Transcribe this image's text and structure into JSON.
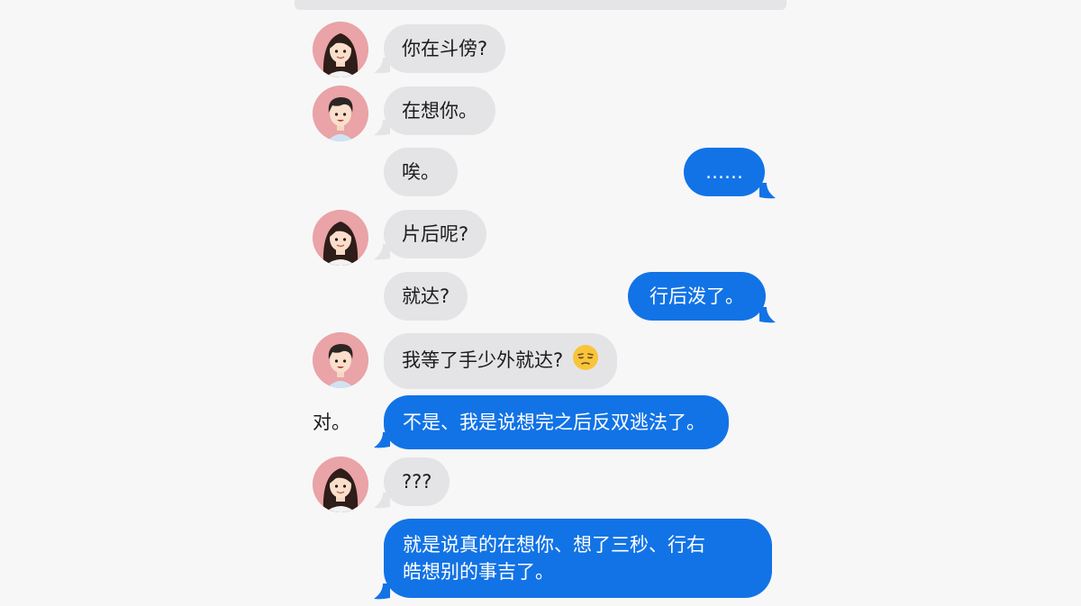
{
  "colors": {
    "incoming_bubble": "#e4e4e7",
    "outgoing_bubble": "#1273e6",
    "avatar_bg": "#eaa3a6"
  },
  "messages": [
    {
      "side": "incoming",
      "avatar": "female-avatar",
      "text": "你在斗傍?"
    },
    {
      "side": "incoming",
      "avatar": "male-avatar",
      "text": "在想你。"
    },
    {
      "side": "incoming",
      "avatar": "",
      "text": "唉。"
    },
    {
      "side": "outgoing",
      "text": "……"
    },
    {
      "side": "incoming",
      "avatar": "female-avatar",
      "text": "片后呢?"
    },
    {
      "side": "incoming",
      "avatar": "",
      "text": "就达?"
    },
    {
      "side": "outgoing",
      "text": "行后泼了。"
    },
    {
      "side": "incoming",
      "avatar": "male-avatar",
      "text": "我等了手少外就达?",
      "emoji": "unamused-face-emoji"
    },
    {
      "side": "standalone",
      "text": "对。"
    },
    {
      "side": "outgoing",
      "text": "不是、我是说想完之后反双逃法了。"
    },
    {
      "side": "incoming",
      "avatar": "female-avatar",
      "text": "???"
    },
    {
      "side": "outgoing",
      "lines": [
        "就是说真的在想你、想了三秒、行右",
        "皓想别的事吉了。"
      ]
    }
  ]
}
